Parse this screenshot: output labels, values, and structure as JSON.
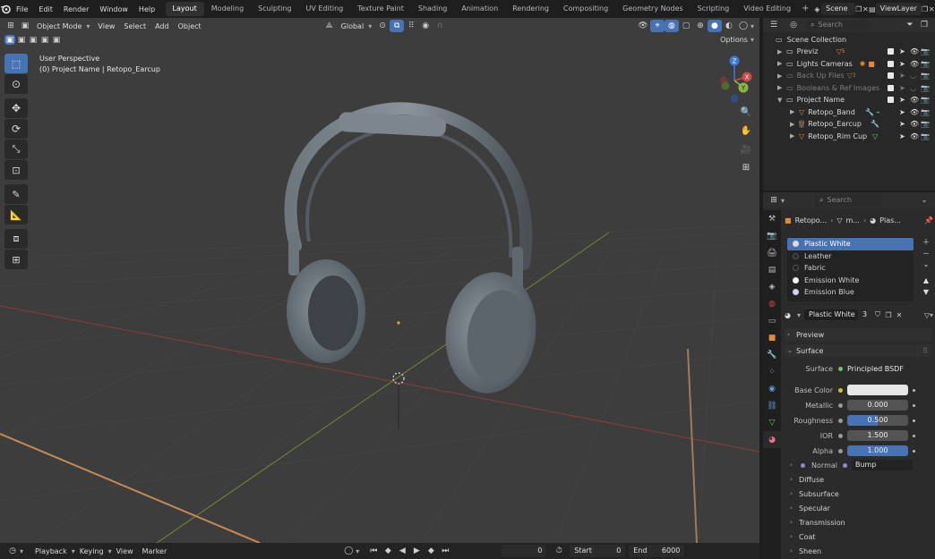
{
  "menubar": {
    "items": [
      "File",
      "Edit",
      "Render",
      "Window",
      "Help"
    ],
    "workspaces": [
      "Layout",
      "Modeling",
      "Sculpting",
      "UV Editing",
      "Texture Paint",
      "Shading",
      "Animation",
      "Rendering",
      "Compositing",
      "Geometry Nodes",
      "Scripting",
      "Video Editing"
    ],
    "active_workspace": "Layout",
    "add_workspace": "+",
    "scene_name": "Scene",
    "view_layer": "ViewLayer"
  },
  "viewport_header": {
    "mode": "Object Mode",
    "menus": [
      "View",
      "Select",
      "Add",
      "Object"
    ],
    "transform_orientation": "Global",
    "options_label": "Options"
  },
  "viewport": {
    "view_name": "User Perspective",
    "object_info": "(0) Project Name | Retopo_Earcup",
    "gizmo_axes": {
      "x": "X",
      "y": "Y",
      "z": "Z"
    }
  },
  "timeline": {
    "menus": [
      "Playback",
      "Keying",
      "View",
      "Marker"
    ],
    "current_frame": "0",
    "start_label": "Start",
    "start_value": "0",
    "end_label": "End",
    "end_value": "6000"
  },
  "outliner": {
    "search_placeholder": "Search",
    "root": "Scene Collection",
    "rows": [
      {
        "label": "Previz",
        "badge": "5",
        "dim": false
      },
      {
        "label": "Lights Cameras",
        "badge": "",
        "dim": false
      },
      {
        "label": "Back Up Files",
        "badge": "3",
        "dim": true
      },
      {
        "label": "Booleans & Ref Images",
        "badge": "",
        "dim": true
      },
      {
        "label": "Project Name",
        "badge": "",
        "dim": false
      },
      {
        "label": "Retopo_Band",
        "badge": "",
        "dim": false
      },
      {
        "label": "Retopo_Earcup",
        "badge": "",
        "dim": false
      },
      {
        "label": "Retopo_Rim Cup",
        "badge": "",
        "dim": false
      }
    ]
  },
  "properties": {
    "search_placeholder": "Search",
    "breadcrumb": [
      "Retopo...",
      "m...",
      "Plas..."
    ],
    "material_slots": [
      {
        "label": "Plastic White",
        "color": "#dcdcdc",
        "selected": true
      },
      {
        "label": "Leather",
        "color": "#2a2a2a",
        "selected": false
      },
      {
        "label": "Fabric",
        "color": "#222222",
        "selected": false
      },
      {
        "label": "Emission White",
        "color": "#f2f2f2",
        "selected": false
      },
      {
        "label": "Emission Blue",
        "color": "#c8d4f0",
        "selected": false
      }
    ],
    "material_name": "Plastic White",
    "user_count": "3",
    "panels": {
      "preview": "Preview",
      "surface": "Surface",
      "surface_label": "Surface",
      "surface_shader": "Principled BSDF",
      "base_color_label": "Base Color",
      "base_color": "#e6e6e6",
      "metallic_label": "Metallic",
      "metallic": "0.000",
      "roughness_label": "Roughness",
      "roughness": "0.500",
      "ior_label": "IOR",
      "ior": "1.500",
      "alpha_label": "Alpha",
      "alpha": "1.000",
      "normal_label": "Normal",
      "normal": "Bump",
      "subpanels": [
        "Diffuse",
        "Subsurface",
        "Specular",
        "Transmission",
        "Coat",
        "Sheen"
      ]
    }
  },
  "colors": {
    "accent": "#4772b3",
    "viewport_bg": "#3d3d3d",
    "x_axis": "#c94a4a",
    "y_axis": "#8db840",
    "z_axis": "#3b7ad8"
  }
}
